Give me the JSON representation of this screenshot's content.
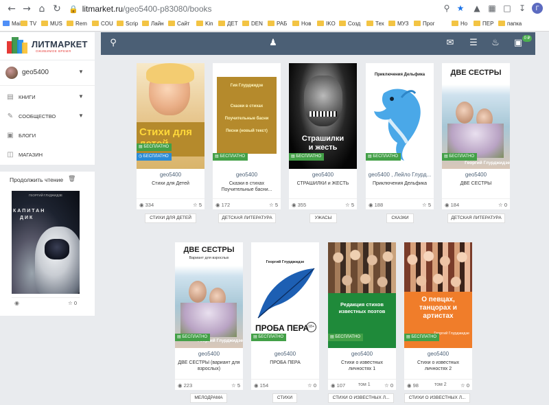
{
  "browser": {
    "url_host": "litmarket.ru",
    "url_path": "/geo5400-p83080/books",
    "avatar_letter": "Г",
    "bookmarks": [
      "Mail",
      "TV",
      "MUS",
      "Rem",
      "COU",
      "Scrip",
      "Лайн",
      "Сайт",
      "Kin",
      "ДЕТ",
      "DEN",
      "РАБ",
      "Нов",
      "IKO",
      "Созд",
      "Тех",
      "МУЗ",
      "Прог",
      "Но",
      "ПЕР",
      "папка"
    ]
  },
  "site": {
    "logo": "ЛИТМАРКЕТ",
    "logo_sub": "ОЖИВИМОЕ ВРЕМЯ",
    "notification_count": "0 ₽",
    "colors": {
      "topbar": "#4b5f75",
      "free": "#43a047",
      "free_blue": "#2b8bd6"
    }
  },
  "sidebar": {
    "username": "geo5400",
    "menu": [
      {
        "label": "КНИГИ",
        "icon": "book-icon",
        "caret": true
      },
      {
        "label": "СООБЩЕСТВО",
        "icon": "community-icon",
        "caret": true
      },
      {
        "label": "БЛОГИ",
        "icon": "blog-icon",
        "caret": false
      },
      {
        "label": "МАГАЗИН",
        "icon": "shop-icon",
        "caret": false
      }
    ],
    "continue_reading": {
      "title": "Продолжить чтение",
      "cover_author": "ГЕОРГИЙ ГЛУДЖИДЗЕ",
      "cover_title_1": "КАПИТАН",
      "cover_title_2": "ДИК",
      "stars": "0"
    }
  },
  "books": [
    {
      "author": "geo5400",
      "title": "Стихи для Детей",
      "views": "334",
      "stars": "5",
      "genre": "СТИХИ ДЛЯ ДЕТЕЙ",
      "free": "БЕСПЛАТНО",
      "free2": "БЕСПЛАТНО",
      "cover_text": "Стихи для детей"
    },
    {
      "author": "geo5400",
      "title": "Сказки в стихах Поучительные басни...",
      "views": "172",
      "stars": "5",
      "genre": "ДЕТСКАЯ ЛИТЕРАТУРА",
      "free": "БЕСПЛАТНО",
      "cover_author": "Гия Глурджидзе",
      "cover_l1": "Сказки в стихах",
      "cover_l2": "Поучительные басни",
      "cover_l3": "Песни (новый текст)"
    },
    {
      "author": "geo5400",
      "title": "СТРАШИЛКИ и ЖЕСТЬ",
      "views": "355",
      "stars": "5",
      "genre": "УЖАСЫ",
      "free": "БЕСПЛАТНО",
      "cover_l1": "Страшилки",
      "cover_l2": "и жесть"
    },
    {
      "author": "geo5400 , Лейло Глурд...",
      "title": "Приключения Дельфика",
      "views": "188",
      "stars": "5",
      "genre": "СКАЗКИ",
      "free": "БЕСПЛАТНО",
      "cover_text": "Приключения Дельфика"
    },
    {
      "author": "geo5400",
      "title": "ДВЕ СЕСТРЫ",
      "views": "184",
      "stars": "0",
      "genre": "ДЕТСКАЯ ЛИТЕРАТУРА",
      "free": "БЕСПЛАТНО",
      "cover_title": "ДВЕ СЕСТРЫ",
      "cover_author": "Георгий Глурджидзе"
    },
    {
      "author": "geo5400",
      "title": "ДВЕ СЕСТРЫ (вариант для взрослых)",
      "views": "223",
      "stars": "5",
      "genre": "МЕЛОДРАМА",
      "free": "БЕСПЛАТНО",
      "cover_title": "ДВЕ СЕСТРЫ",
      "cover_sub": "Вариант для взрослых",
      "cover_author": "Георгий Глурджидзе"
    },
    {
      "author": "geo5400",
      "title": "ПРОБА ПЕРА",
      "views": "154",
      "stars": "0",
      "genre": "СТИХИ",
      "free": "БЕСПЛАТНО",
      "cover_author": "Георгий Глурджидзе",
      "cover_title": "ПРОБА ПЕРА",
      "age": "18+"
    },
    {
      "author": "geo5400",
      "title": "Стихи о известных личностях 1",
      "views": "107",
      "vol": "том 1",
      "stars": "0",
      "genre": "СТИХИ О ИЗВЕСТНЫХ Л...",
      "free": "БЕСПЛАТНО",
      "cover_text": "Редакция стихов известных поэтов"
    },
    {
      "author": "geo5400",
      "title": "Стихи о известных личностях 2",
      "views": "98",
      "vol": "том 2",
      "stars": "0",
      "genre": "СТИХИ О ИЗВЕСТНЫХ Л...",
      "free": "БЕСПЛАТНО",
      "cover_text": "О певцах, танцорах и артистах",
      "cover_author": "Георгий Глурджидзе"
    }
  ]
}
